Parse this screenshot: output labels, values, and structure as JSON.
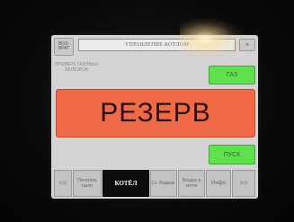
{
  "panel": {
    "back_label": "ВОЗ-ВРАТ",
    "title": "УПРАВЛЕНИЕ КОТЛОМ",
    "close_label": "×",
    "check_label": "ПРОВЕРК ГАЗОВЫХ ЗАТВОРОВ",
    "gas_label": "ГАЗ",
    "status_text": "РЕЗЕРВ",
    "start_label": "ПУСК",
    "colors": {
      "status_bg": "#f06a47",
      "ok_green": "#5fe04e",
      "screen_bg": "#d4d4d4"
    }
  },
  "tabs": {
    "prev": "<<",
    "items": [
      {
        "label": "Питатель пыли"
      },
      {
        "label": "КОТЁЛ"
      },
      {
        "label": "Сх. Разреж."
      },
      {
        "label": "Воздух в котле"
      },
      {
        "label": "Инфо"
      }
    ],
    "next": ">>",
    "active": "КОТЁЛ"
  }
}
